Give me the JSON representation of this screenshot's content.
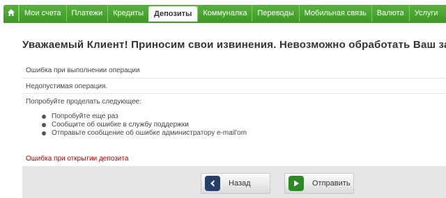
{
  "nav": {
    "home_icon": "home-icon",
    "items": [
      {
        "label": "Мои счета"
      },
      {
        "label": "Платежи"
      },
      {
        "label": "Кредиты"
      },
      {
        "label": "Депозиты",
        "active": true
      },
      {
        "label": "Коммуналка"
      },
      {
        "label": "Переводы"
      },
      {
        "label": "Мобильная связь"
      },
      {
        "label": "Валюта"
      },
      {
        "label": "Услуги"
      }
    ],
    "accent_color": "#4aa530"
  },
  "main": {
    "headline": "Уважаемый Клиент! Приносим свои извинения. Невозможно обработать Ваш зап",
    "error_line1": "Ошибка при выполнении операции",
    "error_line2": "Недопустимая операция.",
    "suggest_title": "Попробуйте проделать следующее:",
    "suggestions": [
      "Попробуйте еще раз",
      "Сообщите об ошибке в службу поддержки",
      "Отправьте сообщение об ошибке администратору e-mail'om"
    ],
    "error_red": "Ошибка при открытии депозита",
    "error_color": "#b80000"
  },
  "buttons": {
    "back_label": "Назад",
    "send_label": "Отправить",
    "back_icon": "chevron-left-icon",
    "send_icon": "play-icon"
  }
}
